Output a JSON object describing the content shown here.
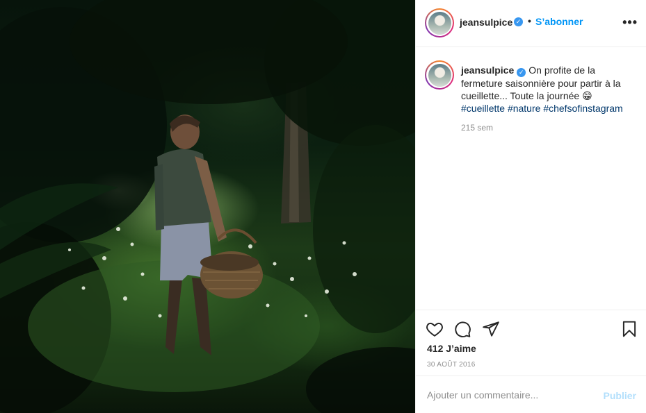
{
  "post": {
    "photo_alt": "Homme tenant un panier en osier dans une clairière de forêt",
    "username": "jeansulpice",
    "verified_glyph": "✓",
    "separator": "•",
    "follow_label": "S’abonner",
    "more_label": "•••",
    "caption": {
      "text": "On profite de la fermeture saisonnière pour partir à la cueillette... Toute la journée 😁",
      "hashtags": [
        "#cueillette",
        "#nature",
        "#chefsofinstagram"
      ],
      "time_ago": "215 sem"
    },
    "likes": "412 J’aime",
    "date": "30 AOÛT 2016",
    "comment": {
      "placeholder": "Ajouter un commentaire...",
      "value": "",
      "publish_label": "Publier"
    },
    "icons": {
      "like": "heart-icon",
      "comment": "comment-icon",
      "share": "paper-plane-icon",
      "save": "bookmark-icon",
      "more": "more-options-icon",
      "verified": "verified-badge-icon"
    },
    "colors": {
      "accent": "#0095f6",
      "hashtag": "#00376b",
      "muted": "#8e8e8e",
      "publish_disabled": "#b2dffc",
      "verified": "#3897f0"
    }
  }
}
